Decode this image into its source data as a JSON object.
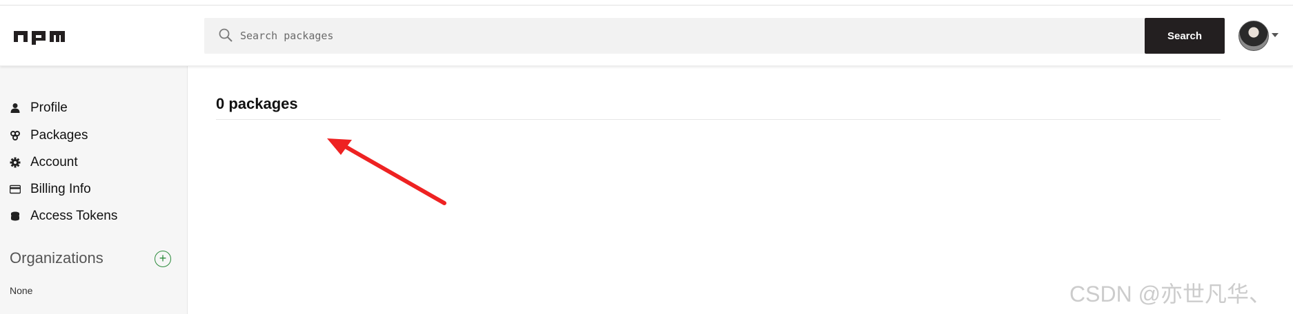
{
  "header": {
    "logo_text": "npm",
    "search": {
      "placeholder": "Search packages",
      "value": ""
    },
    "search_button_label": "Search",
    "avatar_icon": "user-avatar"
  },
  "sidebar": {
    "items": [
      {
        "label": "Profile",
        "icon": "user-icon"
      },
      {
        "label": "Packages",
        "icon": "packages-icon"
      },
      {
        "label": "Account",
        "icon": "gear-icon"
      },
      {
        "label": "Billing Info",
        "icon": "credit-card-icon"
      },
      {
        "label": "Access Tokens",
        "icon": "tokens-icon"
      }
    ],
    "organizations": {
      "title": "Organizations",
      "add_icon": "plus-circle-icon",
      "empty_text": "None"
    }
  },
  "main": {
    "title": "0 packages"
  },
  "annotation": {
    "arrow_color": "#ee2222"
  },
  "watermark": "CSDN @亦世凡华、",
  "colors": {
    "search_button_bg": "#231f20",
    "sidebar_bg": "#f6f6f6",
    "org_add_color": "#2a8a3a"
  }
}
